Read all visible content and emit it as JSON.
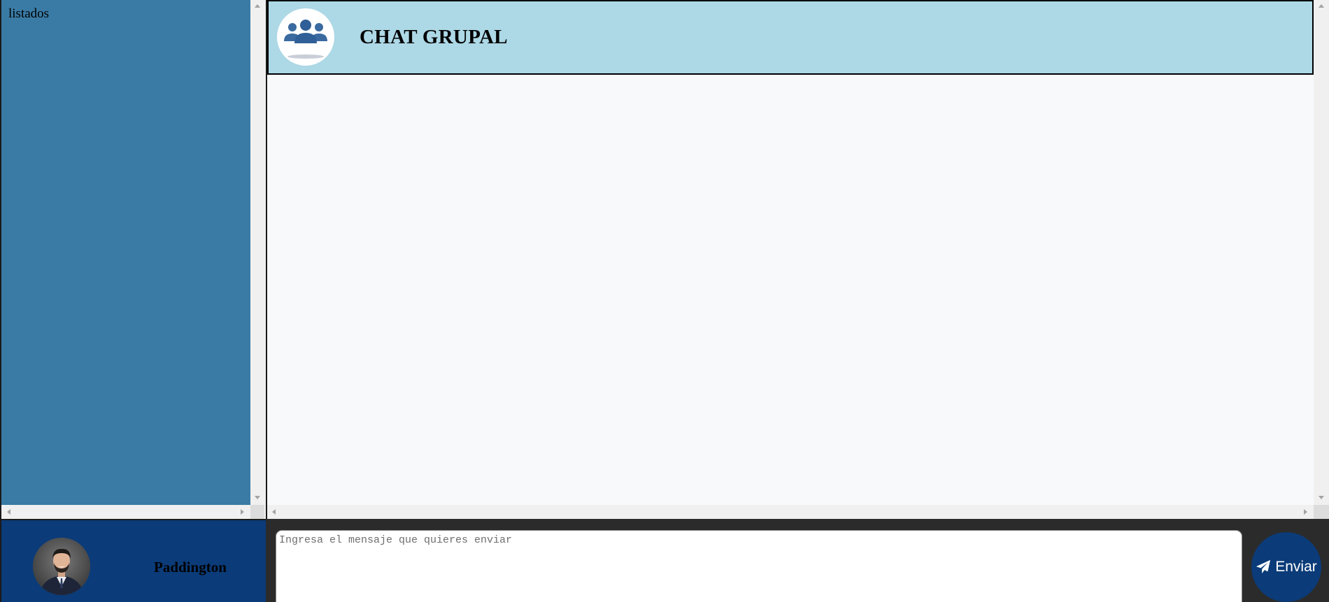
{
  "sidebar": {
    "text": "listados"
  },
  "chat": {
    "title": "CHAT GRUPAL",
    "group_icon": "users-group-icon"
  },
  "profile": {
    "name": "Paddington",
    "avatar_icon": "user-avatar-photo"
  },
  "composer": {
    "placeholder": "Ingresa el mensaje que quieres enviar",
    "value": "",
    "send_label": "Enviar",
    "send_icon": "paper-plane-icon"
  },
  "colors": {
    "sidebar_bg": "#3a7ba5",
    "header_bg": "#add8e6",
    "chat_bg": "#f7f9fb",
    "brand_dark": "#0b3b78",
    "bottom_bar_bg": "#2b2b2b"
  }
}
